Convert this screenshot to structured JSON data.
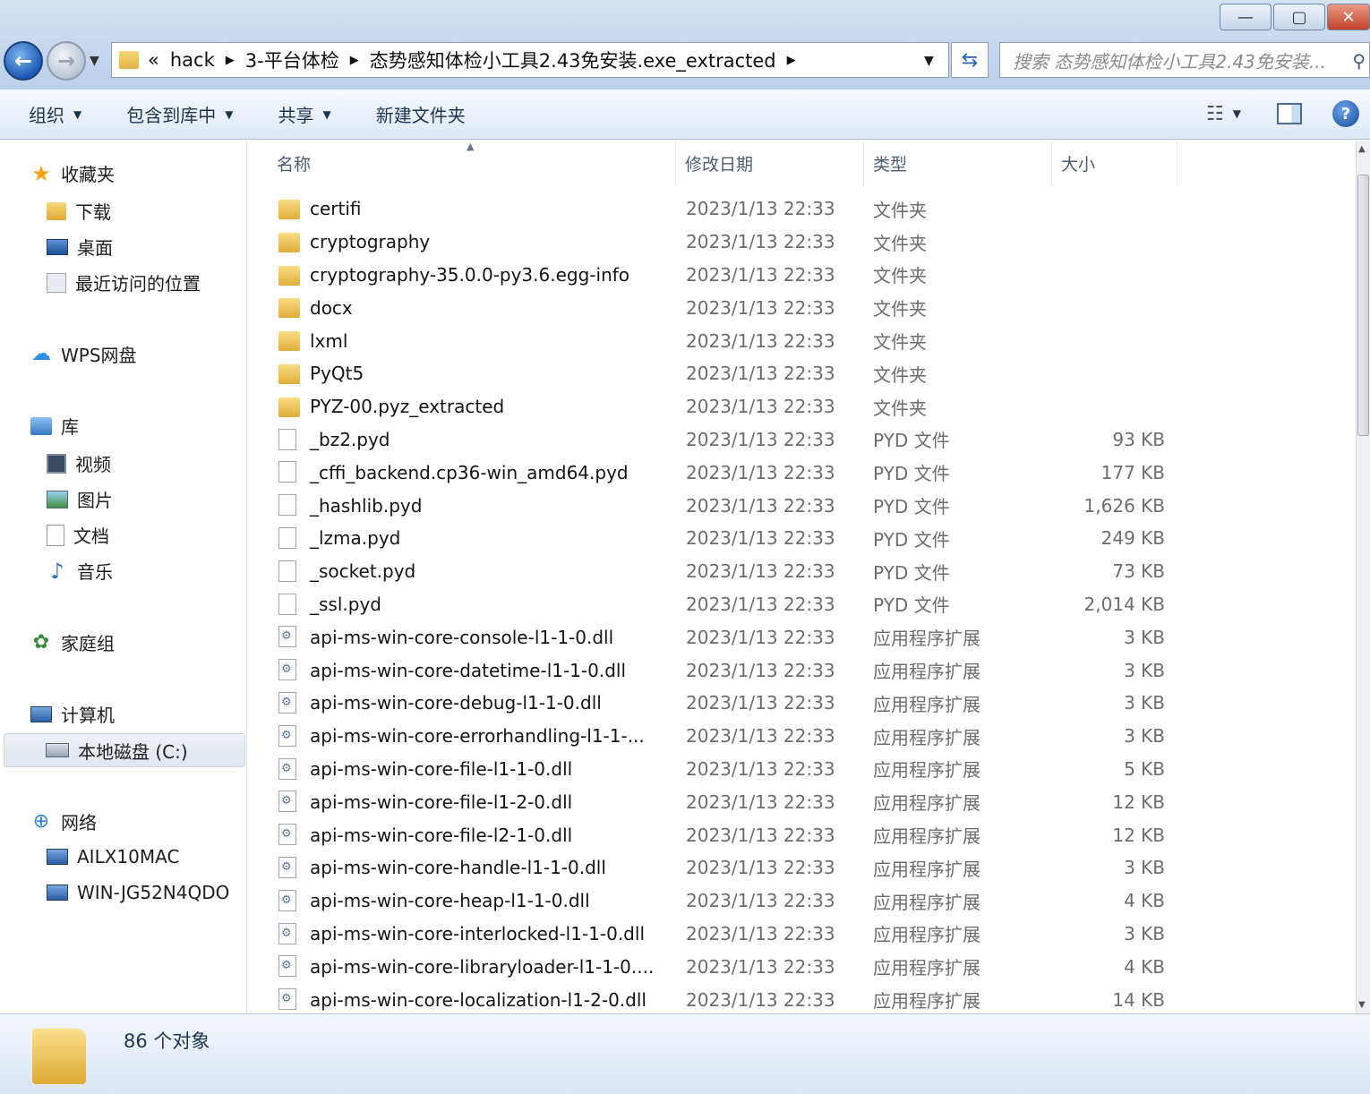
{
  "window": {
    "minimize_glyph": "—",
    "maximize_glyph": "▢",
    "close_glyph": "✕"
  },
  "address": {
    "overflow": "«",
    "crumbs": [
      "hack",
      "3-平台体检",
      "态势感知体检小工具2.43免安装.exe_extracted"
    ],
    "search_placeholder": "搜索 态势感知体检小工具2.43免安装..."
  },
  "toolbar": {
    "organize": "组织",
    "include_in_library": "包含到库中",
    "share": "共享",
    "new_folder": "新建文件夹"
  },
  "nav": {
    "favorites": "收藏夹",
    "downloads": "下载",
    "desktop": "桌面",
    "recent": "最近访问的位置",
    "wps": "WPS网盘",
    "libraries": "库",
    "videos": "视频",
    "pictures": "图片",
    "documents": "文档",
    "music": "音乐",
    "homegroup": "家庭组",
    "computer": "计算机",
    "local_disk": "本地磁盘 (C:)",
    "network": "网络",
    "net_host1": "AILX10MAC",
    "net_host2": "WIN-JG52N4QDO"
  },
  "columns": {
    "name": "名称",
    "date": "修改日期",
    "type": "类型",
    "size": "大小"
  },
  "files": [
    {
      "icon": "folder",
      "name": "certifi",
      "date": "2023/1/13 22:33",
      "type": "文件夹",
      "size": ""
    },
    {
      "icon": "folder",
      "name": "cryptography",
      "date": "2023/1/13 22:33",
      "type": "文件夹",
      "size": ""
    },
    {
      "icon": "folder",
      "name": "cryptography-35.0.0-py3.6.egg-info",
      "date": "2023/1/13 22:33",
      "type": "文件夹",
      "size": ""
    },
    {
      "icon": "folder",
      "name": "docx",
      "date": "2023/1/13 22:33",
      "type": "文件夹",
      "size": ""
    },
    {
      "icon": "folder",
      "name": "lxml",
      "date": "2023/1/13 22:33",
      "type": "文件夹",
      "size": ""
    },
    {
      "icon": "folder",
      "name": "PyQt5",
      "date": "2023/1/13 22:33",
      "type": "文件夹",
      "size": ""
    },
    {
      "icon": "folder",
      "name": "PYZ-00.pyz_extracted",
      "date": "2023/1/13 22:33",
      "type": "文件夹",
      "size": ""
    },
    {
      "icon": "file",
      "name": "_bz2.pyd",
      "date": "2023/1/13 22:33",
      "type": "PYD 文件",
      "size": "93 KB"
    },
    {
      "icon": "file",
      "name": "_cffi_backend.cp36-win_amd64.pyd",
      "date": "2023/1/13 22:33",
      "type": "PYD 文件",
      "size": "177 KB"
    },
    {
      "icon": "file",
      "name": "_hashlib.pyd",
      "date": "2023/1/13 22:33",
      "type": "PYD 文件",
      "size": "1,626 KB"
    },
    {
      "icon": "file",
      "name": "_lzma.pyd",
      "date": "2023/1/13 22:33",
      "type": "PYD 文件",
      "size": "249 KB"
    },
    {
      "icon": "file",
      "name": "_socket.pyd",
      "date": "2023/1/13 22:33",
      "type": "PYD 文件",
      "size": "73 KB"
    },
    {
      "icon": "file",
      "name": "_ssl.pyd",
      "date": "2023/1/13 22:33",
      "type": "PYD 文件",
      "size": "2,014 KB"
    },
    {
      "icon": "dll",
      "name": "api-ms-win-core-console-l1-1-0.dll",
      "date": "2023/1/13 22:33",
      "type": "应用程序扩展",
      "size": "3 KB"
    },
    {
      "icon": "dll",
      "name": "api-ms-win-core-datetime-l1-1-0.dll",
      "date": "2023/1/13 22:33",
      "type": "应用程序扩展",
      "size": "3 KB"
    },
    {
      "icon": "dll",
      "name": "api-ms-win-core-debug-l1-1-0.dll",
      "date": "2023/1/13 22:33",
      "type": "应用程序扩展",
      "size": "3 KB"
    },
    {
      "icon": "dll",
      "name": "api-ms-win-core-errorhandling-l1-1-...",
      "date": "2023/1/13 22:33",
      "type": "应用程序扩展",
      "size": "3 KB"
    },
    {
      "icon": "dll",
      "name": "api-ms-win-core-file-l1-1-0.dll",
      "date": "2023/1/13 22:33",
      "type": "应用程序扩展",
      "size": "5 KB"
    },
    {
      "icon": "dll",
      "name": "api-ms-win-core-file-l1-2-0.dll",
      "date": "2023/1/13 22:33",
      "type": "应用程序扩展",
      "size": "12 KB"
    },
    {
      "icon": "dll",
      "name": "api-ms-win-core-file-l2-1-0.dll",
      "date": "2023/1/13 22:33",
      "type": "应用程序扩展",
      "size": "12 KB"
    },
    {
      "icon": "dll",
      "name": "api-ms-win-core-handle-l1-1-0.dll",
      "date": "2023/1/13 22:33",
      "type": "应用程序扩展",
      "size": "3 KB"
    },
    {
      "icon": "dll",
      "name": "api-ms-win-core-heap-l1-1-0.dll",
      "date": "2023/1/13 22:33",
      "type": "应用程序扩展",
      "size": "4 KB"
    },
    {
      "icon": "dll",
      "name": "api-ms-win-core-interlocked-l1-1-0.dll",
      "date": "2023/1/13 22:33",
      "type": "应用程序扩展",
      "size": "3 KB"
    },
    {
      "icon": "dll",
      "name": "api-ms-win-core-libraryloader-l1-1-0....",
      "date": "2023/1/13 22:33",
      "type": "应用程序扩展",
      "size": "4 KB"
    },
    {
      "icon": "dll",
      "name": "api-ms-win-core-localization-l1-2-0.dll",
      "date": "2023/1/13 22:33",
      "type": "应用程序扩展",
      "size": "14 KB"
    }
  ],
  "status": {
    "count": "86 个对象"
  }
}
